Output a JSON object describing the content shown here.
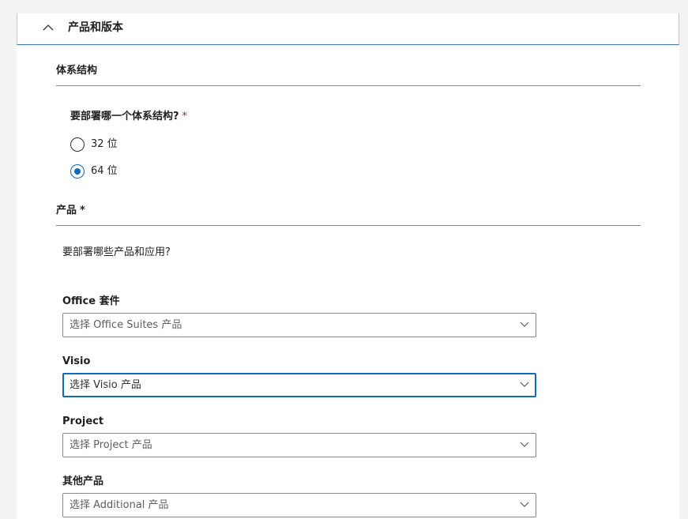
{
  "accordion": {
    "title": "产品和版本",
    "expanded": true
  },
  "architecture": {
    "section_title": "体系结构",
    "question": "要部署哪一个体系结构?",
    "required_marker": "*",
    "options": [
      {
        "label": "32 位",
        "checked": false
      },
      {
        "label": "64 位",
        "checked": true
      }
    ]
  },
  "products": {
    "section_title": "产品",
    "required_marker": "*",
    "description": "要部署哪些产品和应用?",
    "fields": [
      {
        "label": "Office 套件",
        "placeholder": "选择 Office Suites 产品",
        "focused": false
      },
      {
        "label": "Visio",
        "placeholder": "选择 Visio 产品",
        "focused": true
      },
      {
        "label": "Project",
        "placeholder": "选择 Project 产品",
        "focused": false
      },
      {
        "label": "其他产品",
        "placeholder": "选择 Additional 产品",
        "focused": false
      }
    ]
  },
  "colors": {
    "accent": "#0f6cbd",
    "required": "#a4262c",
    "border": "#8a8886"
  },
  "icons": {
    "accordion_toggle": "chevron-up-icon",
    "dropdown_toggle": "chevron-down-icon"
  }
}
